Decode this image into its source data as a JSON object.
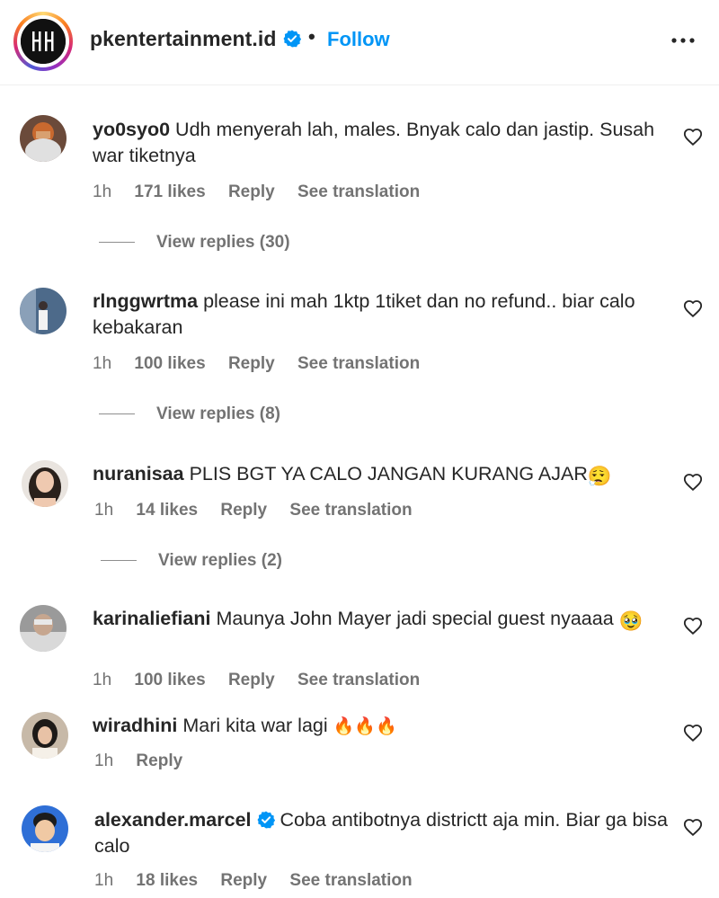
{
  "header": {
    "username": "pkentertainment.id",
    "separator": "•",
    "follow_label": "Follow",
    "more_icon": "more-horizontal-icon"
  },
  "comments": [
    {
      "username": "yo0syo0",
      "text": "Udh menyerah lah, males. Bnyak calo dan jastip. Susah war tiketnya",
      "time": "1h",
      "likes": "171 likes",
      "reply": "Reply",
      "translate": "See translation",
      "view_replies": "View replies (30)"
    },
    {
      "username": "rlnggwrtma",
      "text": "please ini mah 1ktp 1tiket dan no refund.. biar calo kebakaran",
      "time": "1h",
      "likes": "100 likes",
      "reply": "Reply",
      "translate": "See translation",
      "view_replies": "View replies (8)"
    },
    {
      "username": "nuranisaa",
      "text": "PLIS BGT YA CALO JANGAN KURANG AJAR",
      "emoji": "😮‍💨",
      "time": "1h",
      "likes": "14 likes",
      "reply": "Reply",
      "translate": "See translation",
      "view_replies": "View replies (2)"
    },
    {
      "username": "karinaliefiani",
      "text": "Maunya John Mayer jadi special guest nyaaaa",
      "emoji": "🥹",
      "time": "1h",
      "likes": "100 likes",
      "reply": "Reply",
      "translate": "See translation"
    },
    {
      "username": "wiradhini",
      "text": "Mari kita war lagi",
      "emoji": "🔥🔥🔥",
      "time": "1h",
      "reply": "Reply"
    },
    {
      "username": "alexander.marcel",
      "verified": true,
      "text": "Coba antibotnya districtt aja min. Biar ga bisa calo",
      "time": "1h",
      "likes": "18 likes",
      "reply": "Reply",
      "translate": "See translation"
    }
  ],
  "colors": {
    "accent": "#0095f6",
    "text": "#262626",
    "secondary": "#737373"
  }
}
